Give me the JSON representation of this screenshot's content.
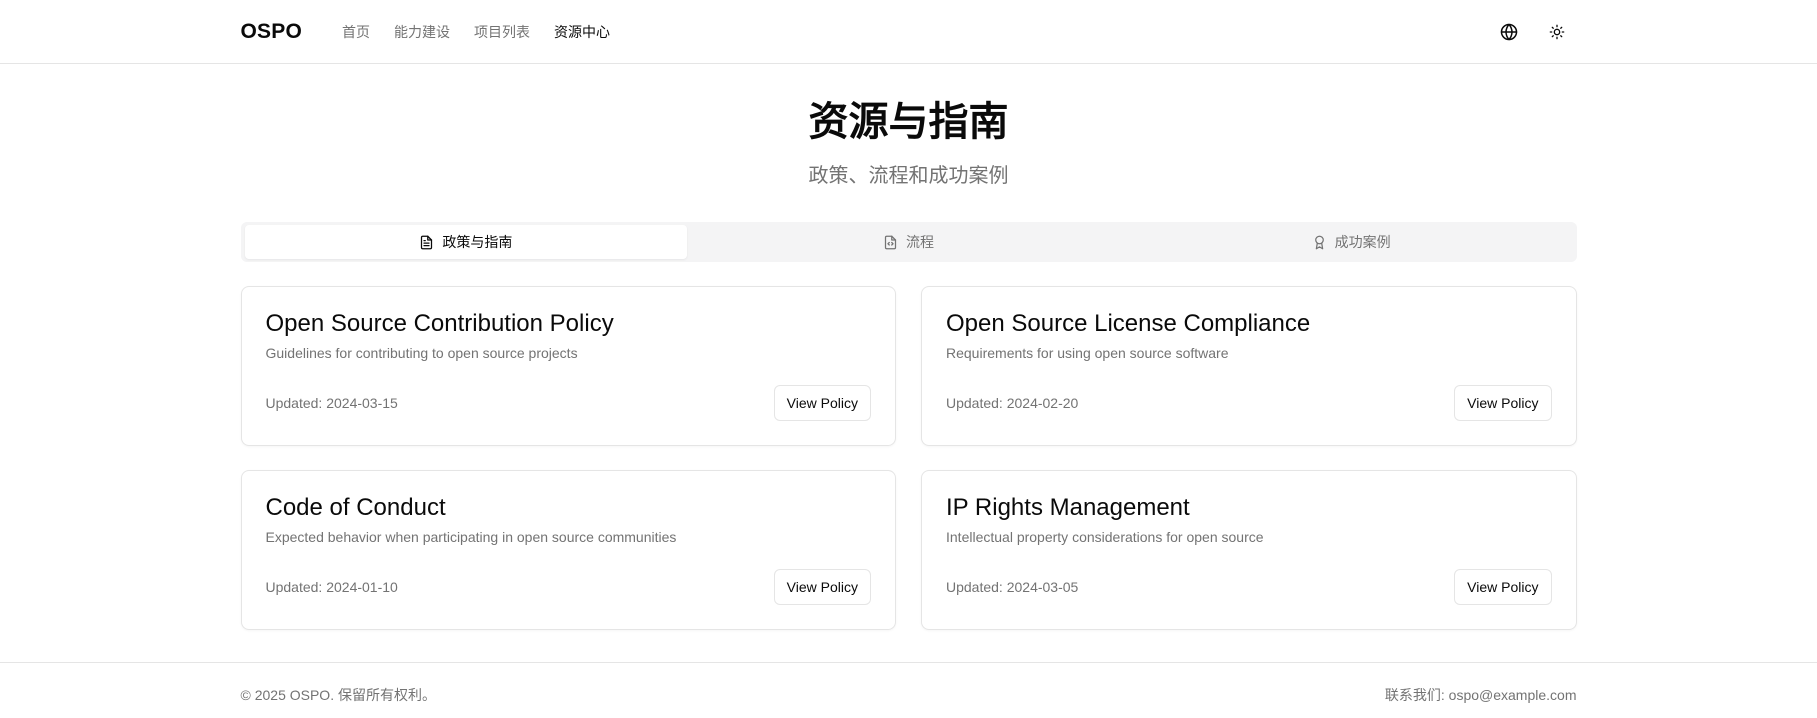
{
  "header": {
    "logo": "OSPO",
    "nav": [
      {
        "label": "首页",
        "active": false
      },
      {
        "label": "能力建设",
        "active": false
      },
      {
        "label": "项目列表",
        "active": false
      },
      {
        "label": "资源中心",
        "active": true
      }
    ],
    "icons": [
      "globe-icon",
      "sun-icon"
    ]
  },
  "hero": {
    "title": "资源与指南",
    "subtitle": "政策、流程和成功案例"
  },
  "tabs": [
    {
      "label": "政策与指南",
      "icon": "file-text-icon",
      "active": true
    },
    {
      "label": "流程",
      "icon": "file-code-icon",
      "active": false
    },
    {
      "label": "成功案例",
      "icon": "award-icon",
      "active": false
    }
  ],
  "cards": [
    {
      "title": "Open Source Contribution Policy",
      "description": "Guidelines for contributing to open source projects",
      "updated": "Updated: 2024-03-15",
      "button": "View Policy"
    },
    {
      "title": "Open Source License Compliance",
      "description": "Requirements for using open source software",
      "updated": "Updated: 2024-02-20",
      "button": "View Policy"
    },
    {
      "title": "Code of Conduct",
      "description": "Expected behavior when participating in open source communities",
      "updated": "Updated: 2024-01-10",
      "button": "View Policy"
    },
    {
      "title": "IP Rights Management",
      "description": "Intellectual property considerations for open source",
      "updated": "Updated: 2024-03-05",
      "button": "View Policy"
    }
  ],
  "footer": {
    "copyright": "© 2025 OSPO. 保留所有权利。",
    "contact": "联系我们: ospo@example.com"
  },
  "colors": {
    "text": "#0a0a0a",
    "muted": "#737373",
    "border": "#e5e5e5",
    "tab_bg": "#f4f4f5"
  }
}
